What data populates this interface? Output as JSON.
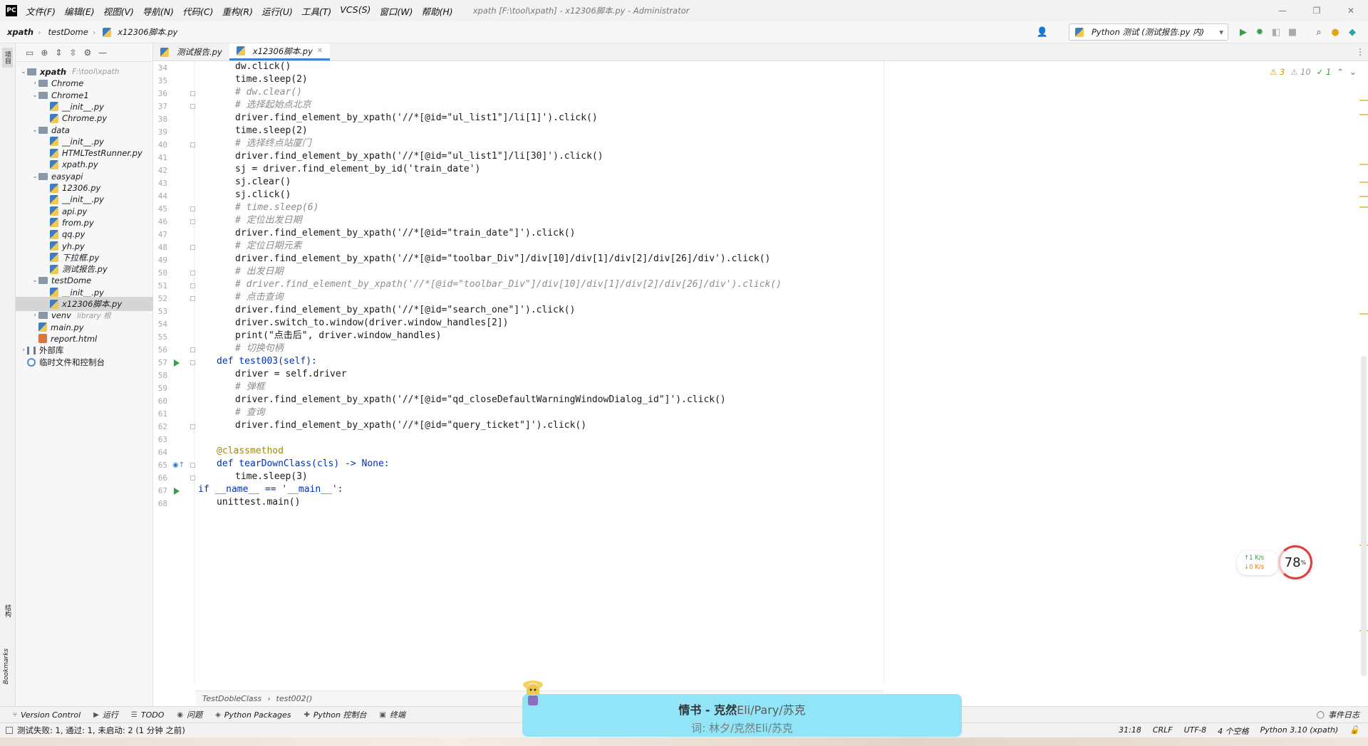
{
  "menubar": {
    "logo": "PC",
    "items": [
      "文件(F)",
      "编辑(E)",
      "视图(V)",
      "导航(N)",
      "代码(C)",
      "重构(R)",
      "运行(U)",
      "工具(T)",
      "VCS(S)",
      "窗口(W)",
      "帮助(H)"
    ],
    "title": "xpath [F:\\tool\\xpath] - x12306脚本.py - Administrator",
    "win_min": "—",
    "win_max": "❐",
    "win_close": "✕"
  },
  "navbar": {
    "crumbs": [
      "xpath",
      "testDome",
      "x12306脚本.py"
    ],
    "run_config": "Python 测试 (测试报告.py 内)"
  },
  "leftstrip": {
    "project_label": "项目",
    "structure_label": "结构",
    "bookmarks_label": "Bookmarks"
  },
  "tree": [
    {
      "label": "xpath",
      "hint": "F:\\tool\\xpath",
      "type": "folder",
      "depth": 0,
      "expanded": true,
      "bold": true
    },
    {
      "label": "Chrome",
      "type": "folder",
      "depth": 1,
      "expanded": false
    },
    {
      "label": "Chrome1",
      "type": "folder",
      "depth": 1,
      "expanded": true
    },
    {
      "label": "__init__.py",
      "type": "py",
      "depth": 2
    },
    {
      "label": "Chrome.py",
      "type": "py",
      "depth": 2
    },
    {
      "label": "data",
      "type": "folder",
      "depth": 1,
      "expanded": true
    },
    {
      "label": "__init__.py",
      "type": "py",
      "depth": 2
    },
    {
      "label": "HTMLTestRunner.py",
      "type": "py",
      "depth": 2
    },
    {
      "label": "xpath.py",
      "type": "py",
      "depth": 2
    },
    {
      "label": "easyapi",
      "type": "folder",
      "depth": 1,
      "expanded": true
    },
    {
      "label": "12306.py",
      "type": "py",
      "depth": 2
    },
    {
      "label": "__init__.py",
      "type": "py",
      "depth": 2
    },
    {
      "label": "api.py",
      "type": "py",
      "depth": 2
    },
    {
      "label": "from.py",
      "type": "py",
      "depth": 2
    },
    {
      "label": "qq.py",
      "type": "py",
      "depth": 2
    },
    {
      "label": "yh.py",
      "type": "py",
      "depth": 2
    },
    {
      "label": "下拉框.py",
      "type": "py",
      "depth": 2
    },
    {
      "label": "测试报告.py",
      "type": "py",
      "depth": 2
    },
    {
      "label": "testDome",
      "type": "folder",
      "depth": 1,
      "expanded": true
    },
    {
      "label": "__init__.py",
      "type": "py",
      "depth": 2
    },
    {
      "label": "x12306脚本.py",
      "type": "py",
      "depth": 2,
      "selected": true
    },
    {
      "label": "venv",
      "hint": "library 根",
      "type": "folder",
      "depth": 1,
      "expanded": false
    },
    {
      "label": "main.py",
      "type": "py",
      "depth": 1
    },
    {
      "label": "report.html",
      "type": "html",
      "depth": 1
    },
    {
      "label": "外部库",
      "type": "lib",
      "depth": 0,
      "expanded": false
    },
    {
      "label": "临时文件和控制台",
      "type": "tmp",
      "depth": 0
    }
  ],
  "tabs": [
    {
      "label": "测试报告.py",
      "active": false
    },
    {
      "label": "x12306脚本.py",
      "active": true
    }
  ],
  "editor": {
    "line_numbers": [
      "34",
      "35",
      "36",
      "37",
      "38",
      "39",
      "40",
      "41",
      "42",
      "43",
      "44",
      "45",
      "46",
      "47",
      "48",
      "49",
      "50",
      "51",
      "52",
      "53",
      "54",
      "55",
      "56",
      "57",
      "58",
      "59",
      "60",
      "61",
      "62",
      "63",
      "64",
      "65",
      "66",
      "67",
      "68"
    ],
    "lines": [
      {
        "text": "dw.click()",
        "indent": 2,
        "style": "code"
      },
      {
        "text": "time.sleep(2)",
        "indent": 2,
        "style": "code"
      },
      {
        "text": "# dw.clear()",
        "indent": 2,
        "style": "comment"
      },
      {
        "text": "# 选择起始点北京",
        "indent": 2,
        "style": "comment"
      },
      {
        "text": "driver.find_element_by_xpath('//*[@id=\"ul_list1\"]/li[1]').click()",
        "indent": 2,
        "style": "code"
      },
      {
        "text": "time.sleep(2)",
        "indent": 2,
        "style": "code"
      },
      {
        "text": "# 选择终点站厦门",
        "indent": 2,
        "style": "comment"
      },
      {
        "text": "driver.find_element_by_xpath('//*[@id=\"ul_list1\"]/li[30]').click()",
        "indent": 2,
        "style": "code"
      },
      {
        "text": "sj = driver.find_element_by_id('train_date')",
        "indent": 2,
        "style": "code"
      },
      {
        "text": "sj.clear()",
        "indent": 2,
        "style": "code"
      },
      {
        "text": "sj.click()",
        "indent": 2,
        "style": "code"
      },
      {
        "text": "# time.sleep(6)",
        "indent": 2,
        "style": "comment"
      },
      {
        "text": "# 定位出发日期",
        "indent": 2,
        "style": "comment"
      },
      {
        "text": "driver.find_element_by_xpath('//*[@id=\"train_date\"]').click()",
        "indent": 2,
        "style": "code"
      },
      {
        "text": "# 定位日期元素",
        "indent": 2,
        "style": "comment"
      },
      {
        "text": "driver.find_element_by_xpath('//*[@id=\"toolbar_Div\"]/div[10]/div[1]/div[2]/div[26]/div').click()",
        "indent": 2,
        "style": "code"
      },
      {
        "text": "# 出发日期",
        "indent": 2,
        "style": "comment"
      },
      {
        "text": "# driver.find_element_by_xpath('//*[@id=\"toolbar_Div\"]/div[10]/div[1]/div[2]/div[26]/div').click()",
        "indent": 2,
        "style": "comment"
      },
      {
        "text": "# 点击查询",
        "indent": 2,
        "style": "comment"
      },
      {
        "text": "driver.find_element_by_xpath('//*[@id=\"search_one\"]').click()",
        "indent": 2,
        "style": "code"
      },
      {
        "text": "driver.switch_to.window(driver.window_handles[2])",
        "indent": 2,
        "style": "code"
      },
      {
        "text": "print(\"点击后\", driver.window_handles)",
        "indent": 2,
        "style": "code"
      },
      {
        "text": "# 切换句柄",
        "indent": 2,
        "style": "comment"
      },
      {
        "text": "def test003(self):",
        "indent": 1,
        "style": "kw"
      },
      {
        "text": "driver = self.driver",
        "indent": 2,
        "style": "code"
      },
      {
        "text": "# 弹框",
        "indent": 2,
        "style": "comment"
      },
      {
        "text": "driver.find_element_by_xpath('//*[@id=\"qd_closeDefaultWarningWindowDialog_id\"]').click()",
        "indent": 2,
        "style": "code"
      },
      {
        "text": "# 查询",
        "indent": 2,
        "style": "comment"
      },
      {
        "text": "driver.find_element_by_xpath('//*[@id=\"query_ticket\"]').click()",
        "indent": 2,
        "style": "code"
      },
      {
        "text": "",
        "indent": 0,
        "style": "code"
      },
      {
        "text": "@classmethod",
        "indent": 1,
        "style": "deco"
      },
      {
        "text": "def tearDownClass(cls) -> None:",
        "indent": 1,
        "style": "kw"
      },
      {
        "text": "time.sleep(3)",
        "indent": 2,
        "style": "code"
      },
      {
        "text": "if __name__ == '__main__':",
        "indent": 0,
        "style": "kw"
      },
      {
        "text": "unittest.main()",
        "indent": 1,
        "style": "code"
      }
    ]
  },
  "inspection": {
    "warnings": "3",
    "weak_warnings": "10",
    "typos": "1"
  },
  "breadcrumbs": [
    "TestDobleClass",
    "test002()"
  ],
  "toolwindows": [
    {
      "icon": "⑂",
      "label": "Version Control"
    },
    {
      "icon": "▶",
      "label": "运行"
    },
    {
      "icon": "☰",
      "label": "TODO"
    },
    {
      "icon": "◉",
      "label": "问题"
    },
    {
      "icon": "◈",
      "label": "Python Packages"
    },
    {
      "icon": "✚",
      "label": "Python 控制台"
    },
    {
      "icon": "▣",
      "label": "终端"
    }
  ],
  "event_log": "事件日志",
  "status": {
    "message": "测试失败: 1, 通过: 1, 未启动: 2 (1 分钟 之前)",
    "position": "31:18",
    "line_sep": "CRLF",
    "encoding": "UTF-8",
    "indent": "4 个空格",
    "interpreter": "Python 3.10 (xpath)"
  },
  "net_widget": {
    "up": "↑1 K/s",
    "down": "↓0 K/s",
    "percent": "78",
    "percent_unit": "%"
  },
  "music": {
    "line1_title": "情书 - 克然",
    "line1_artist": "Eli/Pary/苏克",
    "line2": "词: 林夕/克然Eli/苏克"
  },
  "colors": {
    "accent": "#4083c9",
    "run_green": "#3c9a48",
    "comment": "#8c8c8c",
    "string": "#067d17",
    "keyword": "#0033b3"
  }
}
